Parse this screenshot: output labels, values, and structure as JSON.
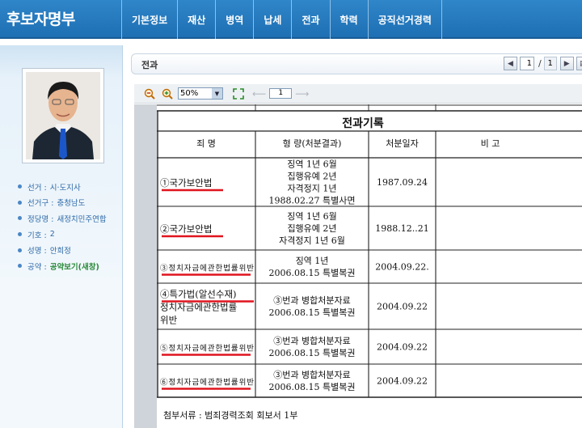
{
  "header": {
    "title": "후보자명부",
    "nav": [
      "기본정보",
      "재산",
      "병역",
      "납세",
      "전과",
      "학력",
      "공직선거경력"
    ]
  },
  "sidebar": {
    "items": [
      {
        "label": "선거 :",
        "value": "시·도지사"
      },
      {
        "label": "선거구 :",
        "value": "충청남도"
      },
      {
        "label": "정당명 :",
        "value": "새정치민주연합"
      },
      {
        "label": "기호 :",
        "value": "2"
      },
      {
        "label": "성명 :",
        "value": "안희정"
      },
      {
        "label": "공약 :",
        "value": "공약보기(새창)"
      }
    ]
  },
  "content": {
    "title": "전과",
    "pager": {
      "current": "1",
      "separator": "/",
      "total": "1"
    }
  },
  "viewer": {
    "zoom": "50%",
    "page": "1"
  },
  "document": {
    "heading": "전과기록",
    "columns": [
      "죄    명",
      "형    량(처분결과)",
      "처분일자",
      "비    고"
    ],
    "rows": [
      {
        "crime": [
          "①국가보안법"
        ],
        "sentence": [
          "징역 1년 6월",
          "집행유예 2년",
          "자격정지 1년",
          "1988.02.27 특별사면"
        ],
        "date": "1987.09.24",
        "note": ""
      },
      {
        "crime": [
          "②국가보안법"
        ],
        "sentence": [
          "징역 1년 6월",
          "집행유예 2년",
          "자격정지 1년 6월"
        ],
        "date": "1988.12..21",
        "note": ""
      },
      {
        "crime": [
          "③정치자금에관한법률위반"
        ],
        "sentence": [
          "징역 1년",
          "2006.08.15 특별복권"
        ],
        "date": "2004.09.22.",
        "note": ""
      },
      {
        "crime": [
          "④특가법(알선수재)",
          "정치자금에관한법률",
          "위반"
        ],
        "sentence": [
          "③번과 병합처분자료",
          "2006.08.15 특별복권"
        ],
        "date": "2004.09.22",
        "note": ""
      },
      {
        "crime": [
          "⑤정치자금에관한법률위반"
        ],
        "sentence": [
          "③번과 병합처분자료",
          "2006.08.15 특별복권"
        ],
        "date": "2004.09.22",
        "note": ""
      },
      {
        "crime": [
          "⑥정치자금에관한법률위반"
        ],
        "sentence": [
          "③번과 병합처분자료",
          "2006.08.15 특별복권"
        ],
        "date": "2004.09.22",
        "note": ""
      }
    ],
    "attachment": "첨부서류 : 범죄경력조회 회보서 1부"
  },
  "colors": {
    "header_blue": "#1e6fb3",
    "underline_red": "#e0141e",
    "link_green": "#2a8a3a"
  }
}
